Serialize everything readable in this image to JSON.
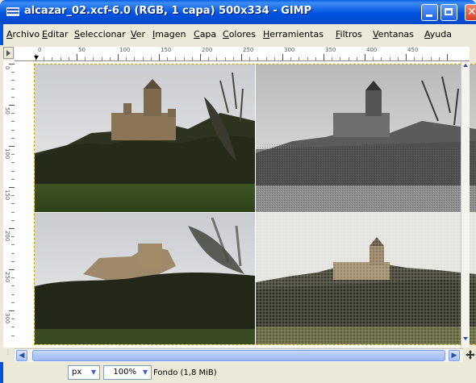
{
  "window": {
    "title": "alcazar_02.xcf-6.0 (RGB, 1 capa) 500x334 - GIMP",
    "colors": {
      "titlebar": "#0053e1",
      "close": "#d5412a",
      "selection_border": "#c8a400"
    }
  },
  "menu": {
    "items": [
      "Archivo",
      "Editar",
      "Seleccionar",
      "Ver",
      "Imagen",
      "Capa",
      "Colores",
      "Herramientas",
      "Filtros",
      "Ventanas",
      "Ayuda"
    ]
  },
  "rulers": {
    "horizontal_labels": [
      "0",
      "50",
      "100",
      "150",
      "200",
      "250",
      "300",
      "350",
      "400",
      "450"
    ],
    "vertical_labels": [
      "0",
      "50",
      "100",
      "150",
      "200",
      "250",
      "300"
    ]
  },
  "canvas": {
    "quadrants": [
      {
        "name": "original-photo",
        "style": "color"
      },
      {
        "name": "grayscale-emboss",
        "style": "grayscale"
      },
      {
        "name": "smudged-painting",
        "style": "color"
      },
      {
        "name": "canvas-texture",
        "style": "color"
      }
    ]
  },
  "status": {
    "unit": "px",
    "zoom": "100%",
    "layer_info": "Fondo (1,8 MiB)"
  }
}
